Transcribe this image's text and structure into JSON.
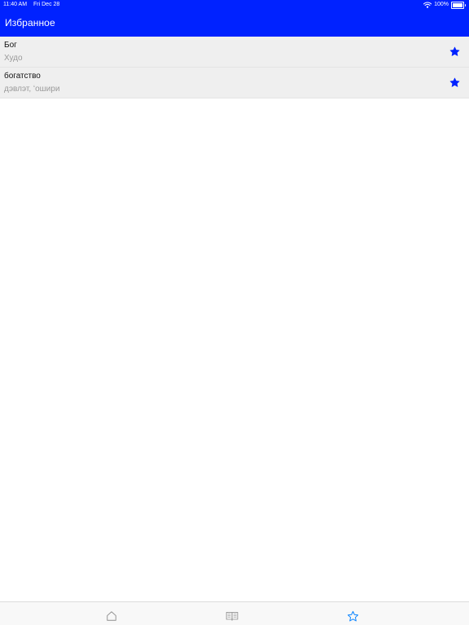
{
  "status_bar": {
    "time": "11:40 AM",
    "date": "Fri Dec 28",
    "battery": "100%",
    "battery_level": 1.0,
    "wifi_icon": "wifi-icon",
    "battery_icon": "battery-icon"
  },
  "header": {
    "title": "Избранное"
  },
  "favorites": [
    {
      "word": "Бог",
      "translation": "Худо",
      "starred": true
    },
    {
      "word": "богатство",
      "translation": "дэвлэт, ʻошири",
      "starred": true
    }
  ],
  "tabs": [
    {
      "name": "home",
      "icon": "home-icon",
      "active": false
    },
    {
      "name": "dictionary",
      "icon": "book-icon",
      "active": false
    },
    {
      "name": "favorites",
      "icon": "star-icon",
      "active": true
    }
  ],
  "colors": {
    "accent": "#0022ff",
    "header_bg": "#0022ff",
    "row_bg": "#efefef",
    "subtitle": "#9a9a9a",
    "tab_inactive": "#8e8e8e",
    "tab_active": "#0a84ff"
  }
}
